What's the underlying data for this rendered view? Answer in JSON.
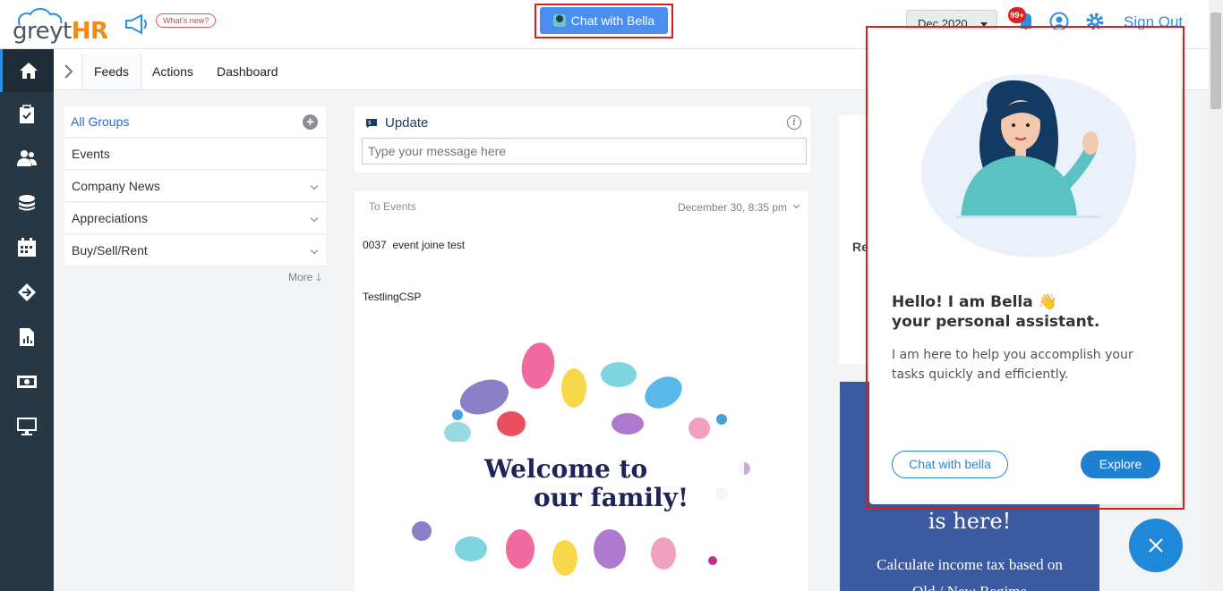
{
  "header": {
    "logo_grey": "greyt",
    "logo_hr": "HR",
    "whats_new": "What's new?",
    "chat_bella_button": "Chat with Bella",
    "month_selector": "Dec 2020",
    "notification_count": "99+",
    "sign_out": "Sign Out"
  },
  "sidebar": {
    "items": [
      {
        "icon": "home-icon"
      },
      {
        "icon": "clipboard-icon"
      },
      {
        "icon": "people-icon"
      },
      {
        "icon": "coins-icon"
      },
      {
        "icon": "calendar-icon"
      },
      {
        "icon": "arrow-right-icon"
      },
      {
        "icon": "report-icon"
      },
      {
        "icon": "money-icon"
      },
      {
        "icon": "monitor-icon"
      }
    ]
  },
  "tabs": [
    {
      "label": "Feeds",
      "active": true
    },
    {
      "label": "Actions",
      "active": false
    },
    {
      "label": "Dashboard",
      "active": false
    }
  ],
  "groups": {
    "items": [
      {
        "label": "All Groups"
      },
      {
        "label": "Events"
      },
      {
        "label": "Company News"
      },
      {
        "label": "Appreciations"
      },
      {
        "label": "Buy/Sell/Rent"
      }
    ],
    "more_label": "More"
  },
  "update": {
    "title": "Update",
    "placeholder": "Type your message here"
  },
  "event_post": {
    "to": "To Events",
    "date": "December 30, 8:35 pm",
    "line1": "0037  event joine test",
    "line2": "TestlingCSP",
    "image_text1": "Welcome to",
    "image_text2": "our family!"
  },
  "right_column": {
    "card_label": "Re",
    "promo_title": "is here!",
    "promo_sub": "Calculate income tax based on",
    "promo_sub2": "Old / New Regime"
  },
  "bella_popup": {
    "hello_line1": "Hello! I am Bella",
    "hello_emoji": "👋",
    "hello_line2": "your personal assistant.",
    "description": "I am here to help you accomplish your tasks quickly and efficiently.",
    "chat_button": "Chat with bella",
    "explore_button": "Explore"
  },
  "colors": {
    "sidebar_bg": "#273744",
    "accent_blue": "#2f8fe0",
    "highlight_red": "#d92020",
    "logo_orange": "#f28a1b"
  }
}
